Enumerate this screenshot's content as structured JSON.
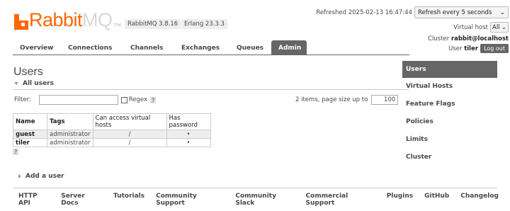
{
  "brand": {
    "rabbit": "Rabbit",
    "mq": "MQ",
    "tm": "TM"
  },
  "versions": {
    "rabbitmq": "RabbitMQ 3.8.16",
    "erlang": "Erlang 23.3.3"
  },
  "header": {
    "refreshed": "Refreshed 2025-02-13 16:47:44",
    "refresh_option": "Refresh every 5 seconds",
    "vhost_label": "Virtual host",
    "vhost_value": "All",
    "cluster_label": "Cluster",
    "cluster_value": "rabbit@localhost",
    "user_label": "User",
    "user_value": "tiler",
    "logout": "Log out"
  },
  "nav": {
    "tabs": [
      "Overview",
      "Connections",
      "Channels",
      "Exchanges",
      "Queues",
      "Admin"
    ],
    "active": "Admin"
  },
  "main": {
    "title": "Users",
    "section": "All users",
    "filter_label": "Filter:",
    "regex_label": "Regex",
    "help": "?",
    "pager_text": "2 items, page size up to",
    "page_size": "100",
    "table": {
      "headers": [
        "Name",
        "Tags",
        "Can access virtual hosts",
        "Has password"
      ],
      "rows": [
        {
          "name": "guest",
          "tags": "administrator",
          "vhosts": "/",
          "password": "•"
        },
        {
          "name": "tiler",
          "tags": "administrator",
          "vhosts": "/",
          "password": "•"
        }
      ]
    },
    "add_user": "Add a user"
  },
  "sidebar": [
    "Users",
    "Virtual Hosts",
    "Feature Flags",
    "Policies",
    "Limits",
    "Cluster"
  ],
  "footer": [
    "HTTP API",
    "Server Docs",
    "Tutorials",
    "Community Support",
    "Community Slack",
    "Commercial Support",
    "Plugins",
    "GitHub",
    "Changelog"
  ],
  "colors": {
    "accent": "#ff6600",
    "nav_active": "#666666"
  }
}
